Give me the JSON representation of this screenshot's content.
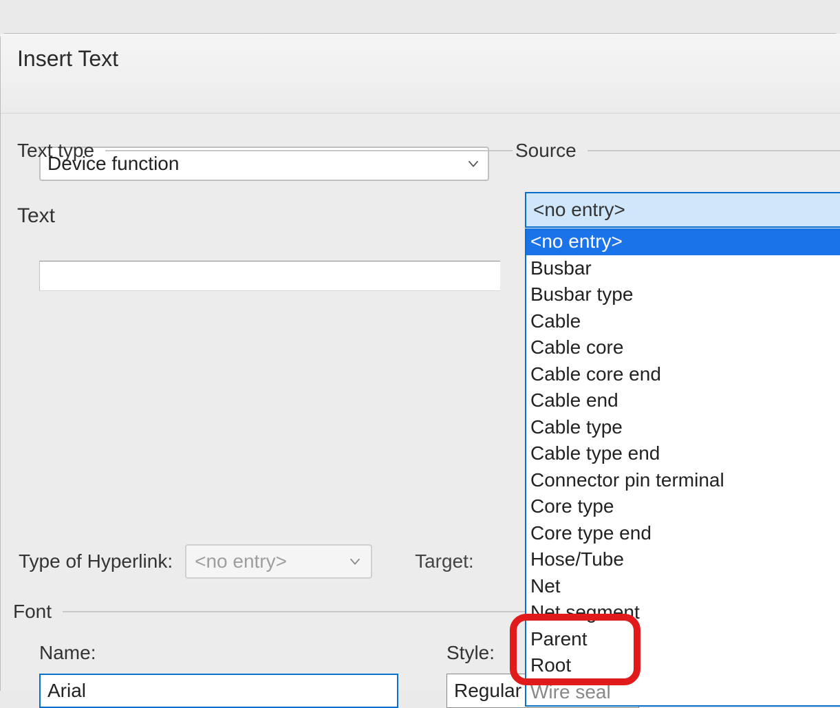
{
  "window": {
    "title": "Insert Text"
  },
  "groups": {
    "text_type": "Text type",
    "source": "Source",
    "text": "Text",
    "font": "Font"
  },
  "text_type_combo": {
    "value": "Device function"
  },
  "text_input": {
    "value": ""
  },
  "hyperlink": {
    "label": "Type of Hyperlink:",
    "value": "<no entry>",
    "target_label": "Target:"
  },
  "font_section": {
    "name_label": "Name:",
    "name_value": "Arial",
    "style_label": "Style:",
    "style_value": "Regular"
  },
  "source_combo": {
    "value": "<no entry>"
  },
  "source_options": [
    "<no entry>",
    "Busbar",
    "Busbar type",
    "Cable",
    "Cable core",
    "Cable core end",
    "Cable end",
    "Cable type",
    "Cable type end",
    "Connector pin terminal",
    "Core type",
    "Core type end",
    "Hose/Tube",
    "Net",
    "Net segment",
    "Parent",
    "Root",
    "Wire seal"
  ],
  "source_selected_index": 0,
  "highlighted_options": [
    "Parent",
    "Root"
  ]
}
